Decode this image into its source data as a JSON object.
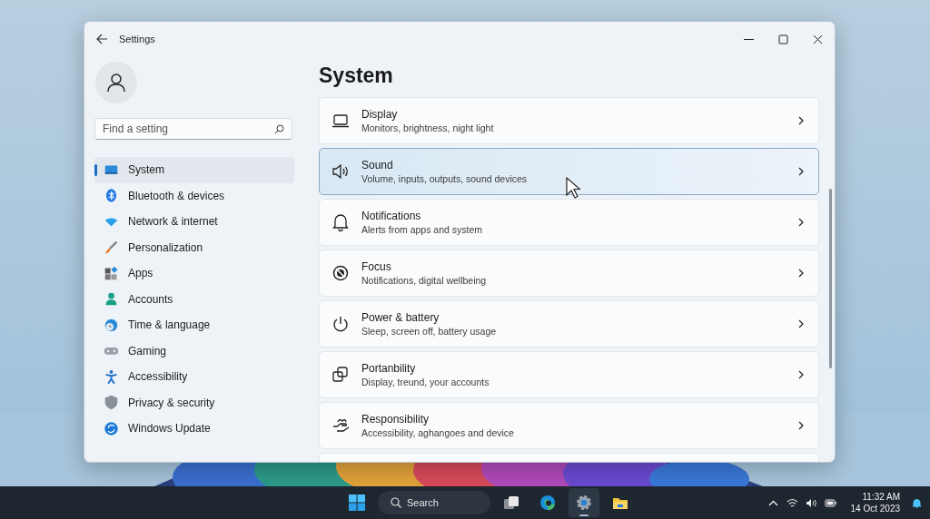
{
  "window": {
    "title": "Settings",
    "heading": "System"
  },
  "search": {
    "placeholder": "Find a setting"
  },
  "sidebar": {
    "items": [
      {
        "label": "System",
        "selected": true
      },
      {
        "label": "Bluetooth & devices",
        "selected": false
      },
      {
        "label": "Network & internet",
        "selected": false
      },
      {
        "label": "Personalization",
        "selected": false
      },
      {
        "label": "Apps",
        "selected": false
      },
      {
        "label": "Accounts",
        "selected": false
      },
      {
        "label": "Time & language",
        "selected": false
      },
      {
        "label": "Gaming",
        "selected": false
      },
      {
        "label": "Accessibility",
        "selected": false
      },
      {
        "label": "Privacy & security",
        "selected": false
      },
      {
        "label": "Windows Update",
        "selected": false
      }
    ]
  },
  "settings": [
    {
      "title": "Display",
      "subtitle": "Monitors, brightness, night light",
      "hovered": false
    },
    {
      "title": "Sound",
      "subtitle": "Volume, inputs, outputs, sound devices",
      "hovered": true
    },
    {
      "title": "Notifications",
      "subtitle": "Alerts from apps and system",
      "hovered": false
    },
    {
      "title": "Focus",
      "subtitle": "Notifications, digital wellbeing",
      "hovered": false
    },
    {
      "title": "Power & battery",
      "subtitle": "Sleep, screen off, battery usage",
      "hovered": false
    },
    {
      "title": "Portanbility",
      "subtitle": "Display, treund, your accounts",
      "hovered": false
    },
    {
      "title": "Responsibility",
      "subtitle": "Accessibility, aghangoes and device",
      "hovered": false
    }
  ],
  "taskbar": {
    "search_label": "Search",
    "apps": [
      {
        "active": false
      },
      {
        "active": false
      },
      {
        "active": true
      },
      {
        "active": false
      }
    ],
    "time": "11:32 AM",
    "date": "14 Oct 2023"
  }
}
